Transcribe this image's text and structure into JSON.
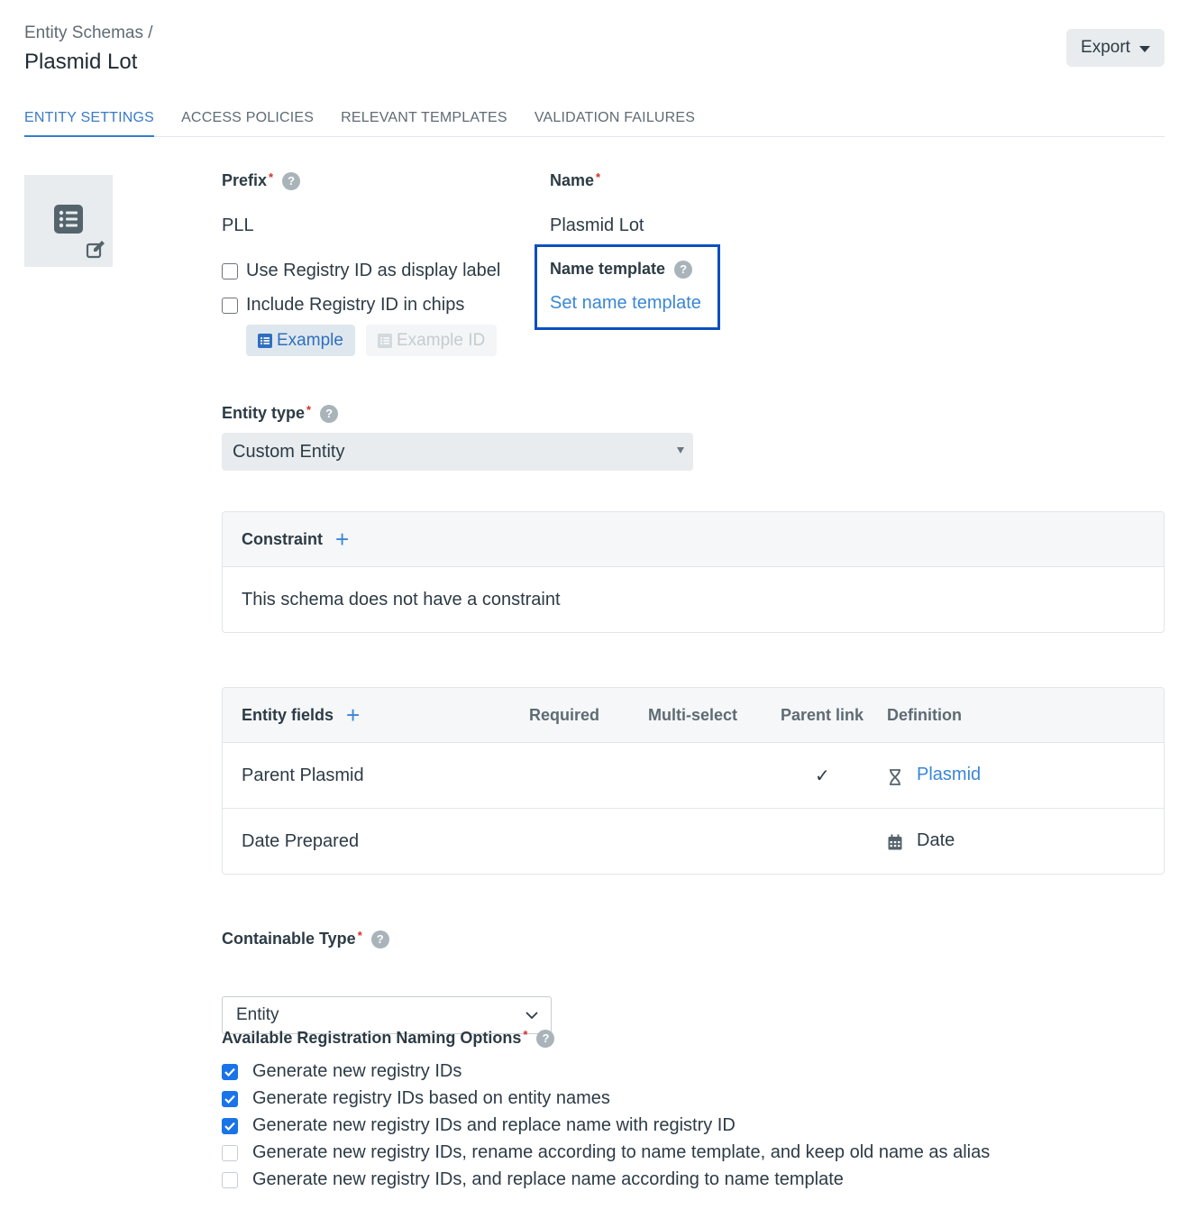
{
  "header": {
    "breadcrumb": "Entity Schemas /",
    "title": "Plasmid Lot",
    "export_label": "Export"
  },
  "tabs": [
    {
      "label": "ENTITY SETTINGS",
      "active": true
    },
    {
      "label": "ACCESS POLICIES",
      "active": false
    },
    {
      "label": "RELEVANT TEMPLATES",
      "active": false
    },
    {
      "label": "VALIDATION FAILURES",
      "active": false
    }
  ],
  "prefix": {
    "label": "Prefix",
    "required_mark": "*",
    "value": "PLL"
  },
  "name": {
    "label": "Name",
    "required_mark": "*",
    "value": "Plasmid Lot"
  },
  "name_template": {
    "label": "Name template",
    "link": "Set name template"
  },
  "display_options": [
    {
      "label": "Use Registry ID as display label",
      "checked": false
    },
    {
      "label": "Include Registry ID in chips",
      "checked": false
    }
  ],
  "chips": {
    "example": "Example",
    "example_id": "Example ID"
  },
  "entity_type": {
    "label": "Entity type",
    "required_mark": "*",
    "value": "Custom Entity"
  },
  "constraint": {
    "title": "Constraint",
    "empty_text": "This schema does not have a constraint"
  },
  "entity_fields": {
    "title": "Entity fields",
    "columns": [
      "Required",
      "Multi-select",
      "Parent link",
      "Definition"
    ],
    "rows": [
      {
        "name": "Parent Plasmid",
        "parent_link": "✓",
        "definition": "Plasmid",
        "definition_is_link": true,
        "definition_icon": "dna-icon"
      },
      {
        "name": "Date Prepared",
        "parent_link": "",
        "definition": "Date",
        "definition_is_link": false,
        "definition_icon": "calendar-icon"
      }
    ]
  },
  "containable_type": {
    "label": "Containable Type",
    "required_mark": "*",
    "value": "Entity"
  },
  "naming_options": {
    "label": "Available Registration Naming Options",
    "required_mark": "*",
    "items": [
      {
        "label": "Generate new registry IDs",
        "checked": true
      },
      {
        "label": "Generate registry IDs based on entity names",
        "checked": true
      },
      {
        "label": "Generate new registry IDs and replace name with registry ID",
        "checked": true
      },
      {
        "label": "Generate new registry IDs, rename according to name template, and keep old name as alias",
        "checked": false
      },
      {
        "label": "Generate new registry IDs, and replace name according to name template",
        "checked": false
      }
    ]
  },
  "colors": {
    "accent": "#3a7bc8",
    "link": "#3a86d6",
    "highlight_box": "#0d4fbf",
    "required": "#d0312d",
    "checkbox_checked": "#1a73e8"
  }
}
